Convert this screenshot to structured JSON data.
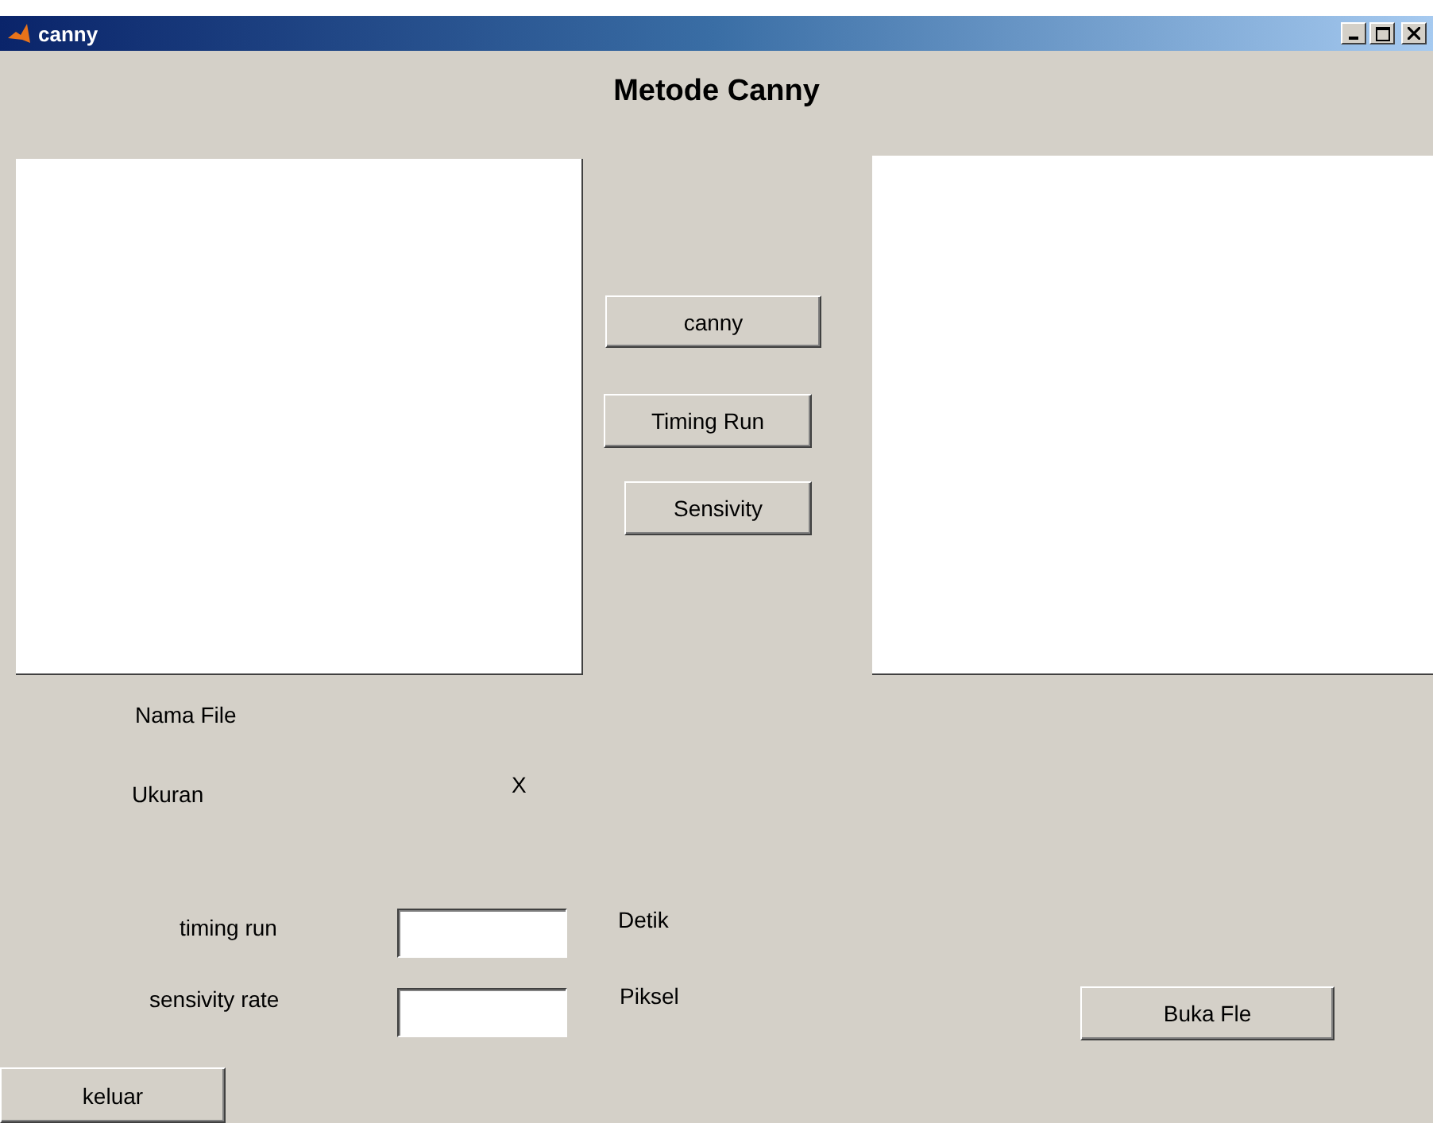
{
  "window": {
    "title": "canny"
  },
  "heading": "Metode Canny",
  "buttons": [
    {
      "label": "canny"
    },
    {
      "label": "Timing Run"
    },
    {
      "label": "Sensivity"
    },
    {
      "label": "Buka Fle"
    },
    {
      "label": "keluar"
    }
  ],
  "labels": [
    {
      "text": "Nama File"
    },
    {
      "text": "Ukuran"
    },
    {
      "text": "X"
    },
    {
      "text": "timing run"
    },
    {
      "text": "Detik"
    },
    {
      "text": "sensivity rate"
    },
    {
      "text": "Piksel"
    }
  ]
}
